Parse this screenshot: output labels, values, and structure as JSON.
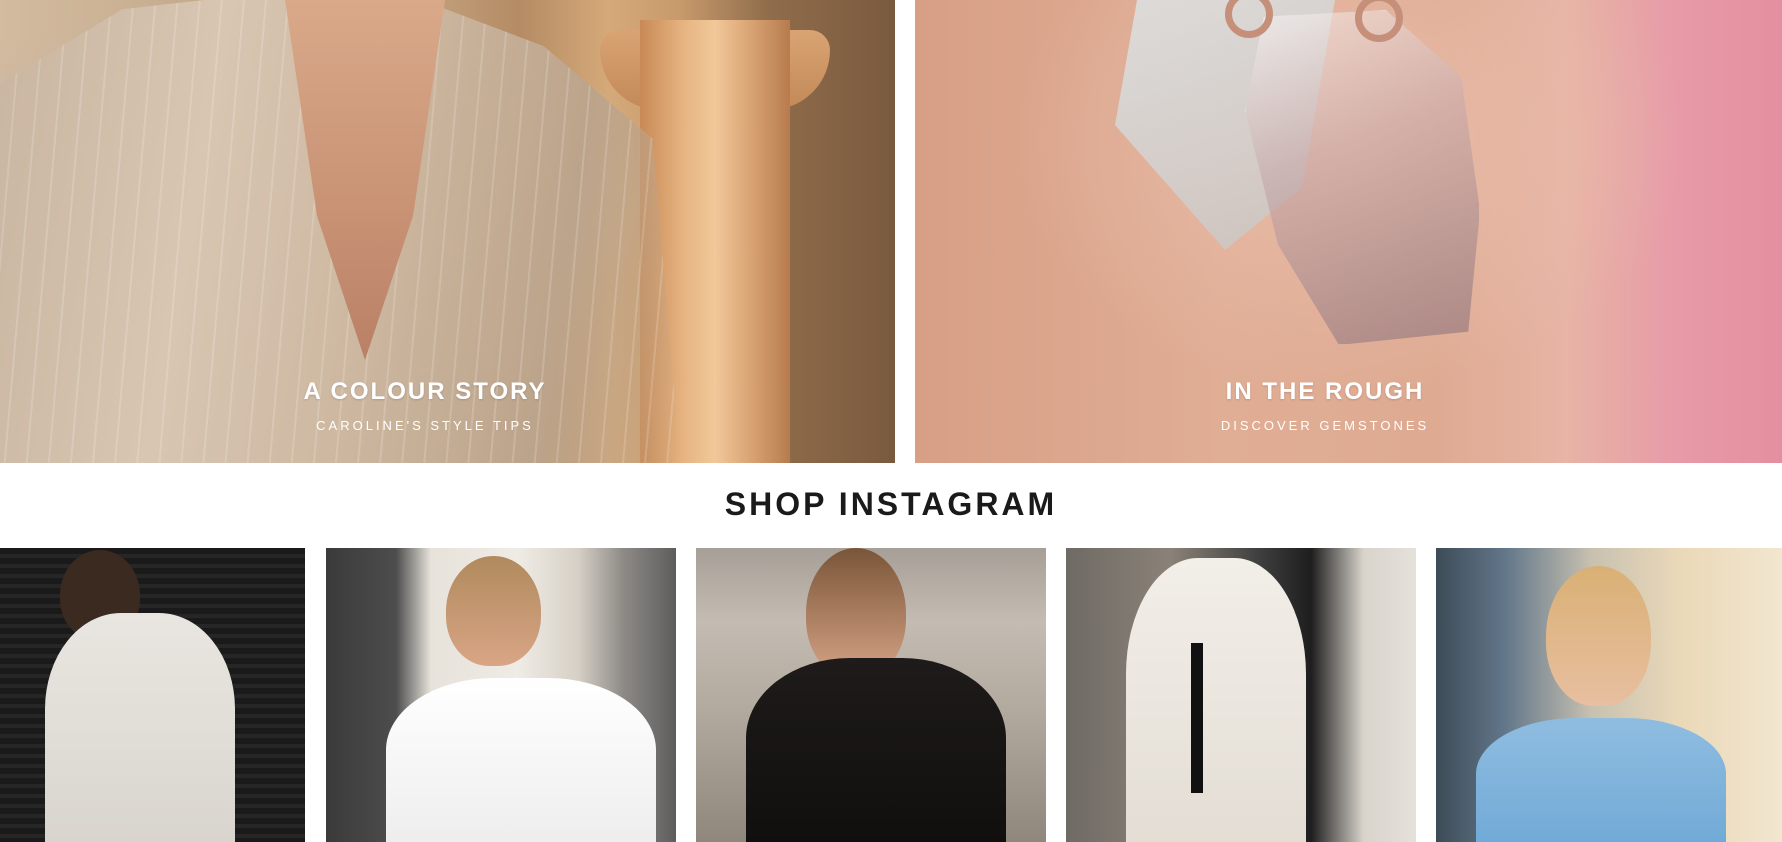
{
  "hero": [
    {
      "title": "A COLOUR STORY",
      "subtitle": "CAROLINE'S STYLE TIPS"
    },
    {
      "title": "IN THE ROUGH",
      "subtitle": "DISCOVER GEMSTONES"
    }
  ],
  "instagram": {
    "heading": "SHOP INSTAGRAM",
    "posts": [
      {
        "image": "woman-in-white-fringe-dress"
      },
      {
        "image": "woman-in-white-shirt-with-earrings"
      },
      {
        "image": "woman-in-black-puff-sleeve-top-with-sunglasses"
      },
      {
        "image": "woman-in-white-lace-dress-with-black-belt"
      },
      {
        "image": "woman-in-blue-lace-cardigan"
      }
    ]
  },
  "colors": {
    "heading_text": "#1a1a1a",
    "caption_text": "#ffffff",
    "background": "#ffffff"
  }
}
